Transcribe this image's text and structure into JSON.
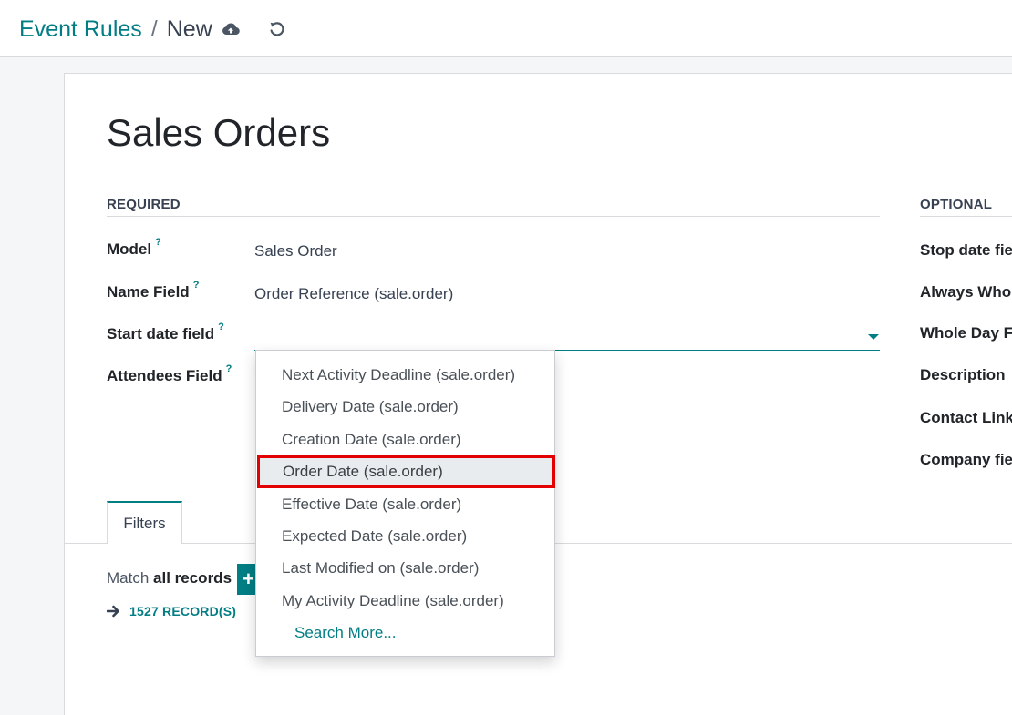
{
  "breadcrumb": {
    "parent": "Event Rules",
    "separator": "/",
    "current": "New"
  },
  "toolbar": {
    "save_icon": "cloud-upload-icon",
    "discard_icon": "undo-icon"
  },
  "form": {
    "title": "Sales Orders",
    "required_heading": "REQUIRED",
    "optional_heading": "OPTIONAL",
    "help_mark": "?",
    "fields": {
      "model": {
        "label": "Model",
        "value": "Sales Order"
      },
      "name_field": {
        "label": "Name Field",
        "value": "Order Reference (sale.order)"
      },
      "start_date_field": {
        "label": "Start date field",
        "value": ""
      },
      "attendees_field": {
        "label": "Attendees Field"
      }
    },
    "optional_fields": [
      "Stop date fie",
      "Always Who",
      "Whole Day F",
      "Description",
      "Contact Link",
      "Company fie"
    ]
  },
  "tabs": {
    "filters": "Filters"
  },
  "filters": {
    "match_prefix": "Match",
    "match_target": "all records",
    "add_label": "+",
    "records": "1527 RECORD(S)"
  },
  "dropdown": {
    "items": [
      "Next Activity Deadline (sale.order)",
      "Delivery Date (sale.order)",
      "Creation Date (sale.order)",
      "Order Date (sale.order)",
      "Effective Date (sale.order)",
      "Expected Date (sale.order)",
      "Last Modified on (sale.order)",
      "My Activity Deadline (sale.order)"
    ],
    "highlighted": "Order Date (sale.order)",
    "highlight_color": "#e30000",
    "search_more": "Search More..."
  },
  "colors": {
    "accent": "#017e84",
    "highlight_border": "#e30000"
  }
}
